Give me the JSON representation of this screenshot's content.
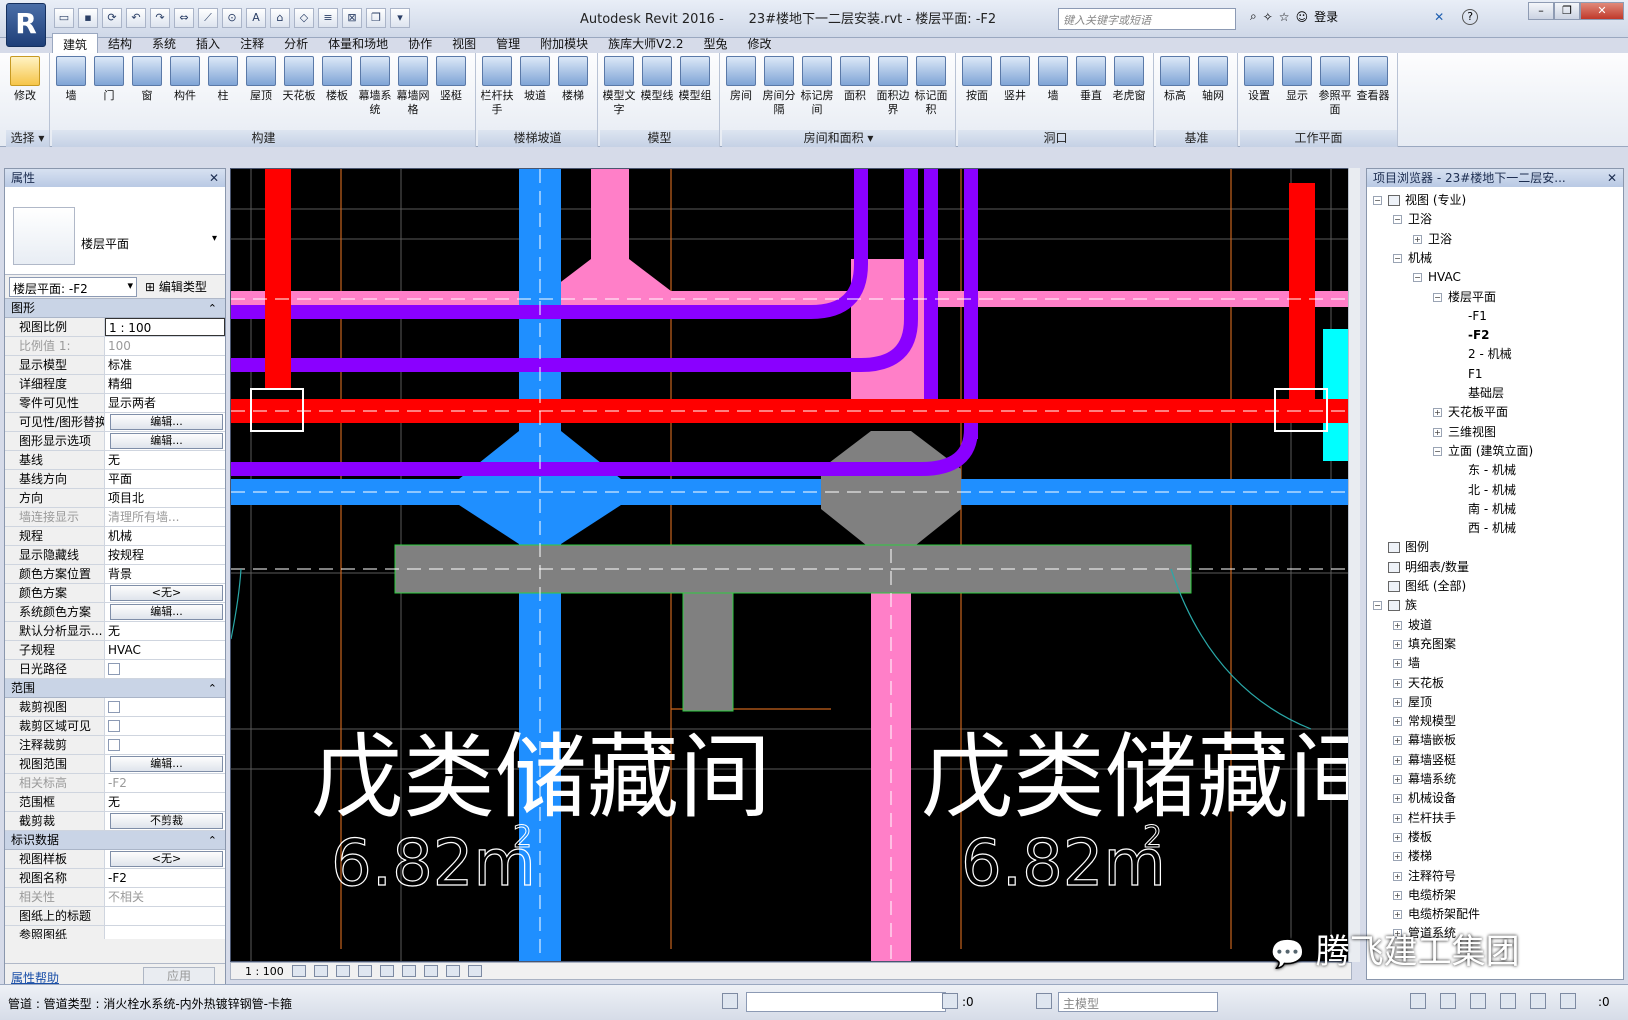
{
  "titlebar": {
    "app_logo": "R",
    "title_left": "Autodesk Revit 2016 -",
    "title_right": "23#楼地下一二层安装.rvt - 楼层平面: -F2",
    "search_placeholder": "键入关键字或短语",
    "login": "登录",
    "help": "?"
  },
  "tabs": [
    "建筑",
    "结构",
    "系统",
    "插入",
    "注释",
    "分析",
    "体量和场地",
    "协作",
    "视图",
    "管理",
    "附加模块",
    "族库大师V2.2",
    "型兔",
    "修改"
  ],
  "ribbon": {
    "panels": [
      {
        "label": "选择 ▾",
        "buttons": [
          "修改"
        ]
      },
      {
        "label": "构建",
        "buttons": [
          "墙",
          "门",
          "窗",
          "构件",
          "柱",
          "屋顶",
          "天花板",
          "楼板",
          "幕墙系统",
          "幕墙网格",
          "竖梃"
        ]
      },
      {
        "label": "楼梯坡道",
        "buttons": [
          "栏杆扶手",
          "坡道",
          "楼梯"
        ]
      },
      {
        "label": "模型",
        "buttons": [
          "模型文字",
          "模型线",
          "模型组"
        ]
      },
      {
        "label": "房间和面积 ▾",
        "buttons": [
          "房间",
          "房间分隔",
          "标记房间",
          "面积",
          "面积边界",
          "标记面积"
        ]
      },
      {
        "label": "洞口",
        "buttons": [
          "按面",
          "竖井",
          "墙",
          "垂直",
          "老虎窗"
        ]
      },
      {
        "label": "基准",
        "buttons": [
          "标高",
          "轴网"
        ]
      },
      {
        "label": "工作平面",
        "buttons": [
          "设置",
          "显示",
          "参照平面",
          "查看器"
        ]
      }
    ]
  },
  "properties": {
    "header": "属性",
    "type_name": "楼层平面",
    "view_selector": "楼层平面: -F2",
    "edit_type": "编辑类型",
    "sections": [
      {
        "name": "图形",
        "rows": [
          [
            "视图比例",
            "1 : 100",
            "input"
          ],
          [
            "比例值 1:",
            "100",
            "dim"
          ],
          [
            "显示模型",
            "标准",
            ""
          ],
          [
            "详细程度",
            "精细",
            ""
          ],
          [
            "零件可见性",
            "显示两者",
            ""
          ],
          [
            "可见性/图形替换",
            "编辑...",
            "btn"
          ],
          [
            "图形显示选项",
            "编辑...",
            "btn"
          ],
          [
            "基线",
            "无",
            ""
          ],
          [
            "基线方向",
            "平面",
            ""
          ],
          [
            "方向",
            "项目北",
            ""
          ],
          [
            "墙连接显示",
            "清理所有墙...",
            "dim"
          ],
          [
            "规程",
            "机械",
            ""
          ],
          [
            "显示隐藏线",
            "按规程",
            ""
          ],
          [
            "颜色方案位置",
            "背景",
            ""
          ],
          [
            "颜色方案",
            "<无>",
            "btn"
          ],
          [
            "系统颜色方案",
            "编辑...",
            "btn"
          ],
          [
            "默认分析显示...",
            "无",
            ""
          ],
          [
            "子规程",
            "HVAC",
            ""
          ],
          [
            "日光路径",
            "",
            "chk"
          ]
        ]
      },
      {
        "name": "范围",
        "rows": [
          [
            "裁剪视图",
            "",
            "chk"
          ],
          [
            "裁剪区域可见",
            "",
            "chk"
          ],
          [
            "注释裁剪",
            "",
            "chk"
          ],
          [
            "视图范围",
            "编辑...",
            "btn"
          ],
          [
            "相关标高",
            "-F2",
            "dim"
          ],
          [
            "范围框",
            "无",
            ""
          ],
          [
            "截剪裁",
            "不剪裁",
            "btn"
          ]
        ]
      },
      {
        "name": "标识数据",
        "rows": [
          [
            "视图样板",
            "<无>",
            "btn"
          ],
          [
            "视图名称",
            "-F2",
            ""
          ],
          [
            "相关性",
            "不相关",
            "dim"
          ],
          [
            "图纸上的标题",
            "",
            ""
          ],
          [
            "参照图纸",
            "",
            ""
          ]
        ]
      }
    ],
    "help_link": "属性帮助",
    "apply": "应用"
  },
  "canvas": {
    "room_labels": [
      {
        "name": "戊类储藏间",
        "area": "6.82m",
        "sup": "2"
      },
      {
        "name": "戊类储藏间",
        "area": "6.82m",
        "sup": "2"
      }
    ],
    "colors": {
      "red": "#ff0000",
      "purple": "#8a00ff",
      "blue": "#1f8fff",
      "pink": "#ff7fc8",
      "grey": "#808080",
      "cyan": "#00ffff",
      "orange": "#c8641e"
    }
  },
  "viewbar": {
    "scale": "1 : 100"
  },
  "browser": {
    "header": "项目浏览器 - 23#楼地下一二层安...",
    "nodes": [
      {
        "label": "视图 (专业)",
        "level": 0,
        "pm": "-",
        "icon": true
      },
      {
        "label": "卫浴",
        "level": 1,
        "pm": "-"
      },
      {
        "label": "卫浴",
        "level": 2,
        "pm": "+"
      },
      {
        "label": "机械",
        "level": 1,
        "pm": "-"
      },
      {
        "label": "HVAC",
        "level": 2,
        "pm": "-"
      },
      {
        "label": "楼层平面",
        "level": 3,
        "pm": "-"
      },
      {
        "label": "-F1",
        "level": 4
      },
      {
        "label": "-F2",
        "level": 4,
        "sel": true
      },
      {
        "label": "2 - 机械",
        "level": 4
      },
      {
        "label": "F1",
        "level": 4
      },
      {
        "label": "基础层",
        "level": 4
      },
      {
        "label": "天花板平面",
        "level": 3,
        "pm": "+"
      },
      {
        "label": "三维视图",
        "level": 3,
        "pm": "+"
      },
      {
        "label": "立面 (建筑立面)",
        "level": 3,
        "pm": "-"
      },
      {
        "label": "东 - 机械",
        "level": 4
      },
      {
        "label": "北 - 机械",
        "level": 4
      },
      {
        "label": "南 - 机械",
        "level": 4
      },
      {
        "label": "西 - 机械",
        "level": 4
      },
      {
        "label": "图例",
        "level": 0,
        "icon": true
      },
      {
        "label": "明细表/数量",
        "level": 0,
        "icon": true
      },
      {
        "label": "图纸 (全部)",
        "level": 0,
        "icon": true
      },
      {
        "label": "族",
        "level": 0,
        "pm": "-",
        "icon": true
      },
      {
        "label": "坡道",
        "level": 1,
        "pm": "+"
      },
      {
        "label": "填充图案",
        "level": 1,
        "pm": "+"
      },
      {
        "label": "墙",
        "level": 1,
        "pm": "+"
      },
      {
        "label": "天花板",
        "level": 1,
        "pm": "+"
      },
      {
        "label": "屋顶",
        "level": 1,
        "pm": "+"
      },
      {
        "label": "常规模型",
        "level": 1,
        "pm": "+"
      },
      {
        "label": "幕墙嵌板",
        "level": 1,
        "pm": "+"
      },
      {
        "label": "幕墙竖梃",
        "level": 1,
        "pm": "+"
      },
      {
        "label": "幕墙系统",
        "level": 1,
        "pm": "+"
      },
      {
        "label": "机械设备",
        "level": 1,
        "pm": "+"
      },
      {
        "label": "栏杆扶手",
        "level": 1,
        "pm": "+"
      },
      {
        "label": "楼板",
        "level": 1,
        "pm": "+"
      },
      {
        "label": "楼梯",
        "level": 1,
        "pm": "+"
      },
      {
        "label": "注释符号",
        "level": 1,
        "pm": "+"
      },
      {
        "label": "电缆桥架",
        "level": 1,
        "pm": "+"
      },
      {
        "label": "电缆桥架配件",
        "level": 1,
        "pm": "+"
      },
      {
        "label": "管道系统",
        "level": 1,
        "pm": "+"
      }
    ]
  },
  "status": {
    "text": "管道 : 管道类型 : 消火栓水系统-内外热镀锌钢管-卡箍",
    "sel_count": ":0",
    "model": "主模型",
    "filter": ":0"
  },
  "watermark": "腾飞建工集团"
}
